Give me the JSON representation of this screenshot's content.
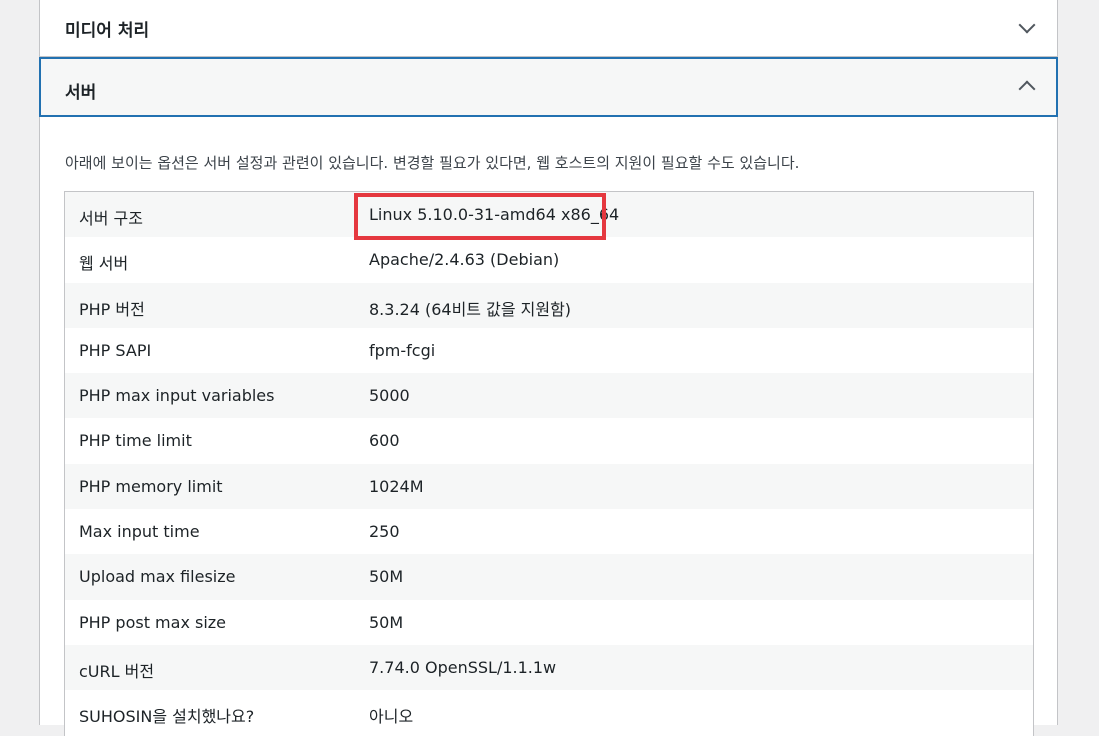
{
  "accordion": {
    "media_title": "미디어 처리",
    "server_title": "서버"
  },
  "server_section": {
    "description": "아래에 보이는 옵션은 서버 설정과 관련이 있습니다. 변경할 필요가 있다면, 웹 호스트의 지원이 필요할 수도 있습니다.",
    "rows": [
      {
        "label": "서버 구조",
        "value": "Linux 5.10.0-31-amd64 x86_64"
      },
      {
        "label": "웹 서버",
        "value": "Apache/2.4.63 (Debian)"
      },
      {
        "label": "PHP 버전",
        "value": "8.3.24 (64비트 값을 지원함)"
      },
      {
        "label": "PHP SAPI",
        "value": "fpm-fcgi"
      },
      {
        "label": "PHP max input variables",
        "value": "5000"
      },
      {
        "label": "PHP time limit",
        "value": "600"
      },
      {
        "label": "PHP memory limit",
        "value": "1024M"
      },
      {
        "label": "Max input time",
        "value": "250"
      },
      {
        "label": "Upload max filesize",
        "value": "50M"
      },
      {
        "label": "PHP post max size",
        "value": "50M"
      },
      {
        "label": "cURL 버전",
        "value": "7.74.0 OpenSSL/1.1.1w"
      },
      {
        "label": "SUHOSIN을 설치했나요?",
        "value": "아니오"
      }
    ]
  },
  "colors": {
    "accent": "#2271b1",
    "highlight": "#e5383f",
    "background": "#f0f0f1",
    "row_alt": "#f6f7f7",
    "border": "#c3c4c7"
  },
  "icons": {
    "media_toggle": "chevron-down-icon",
    "server_toggle": "chevron-up-icon"
  }
}
